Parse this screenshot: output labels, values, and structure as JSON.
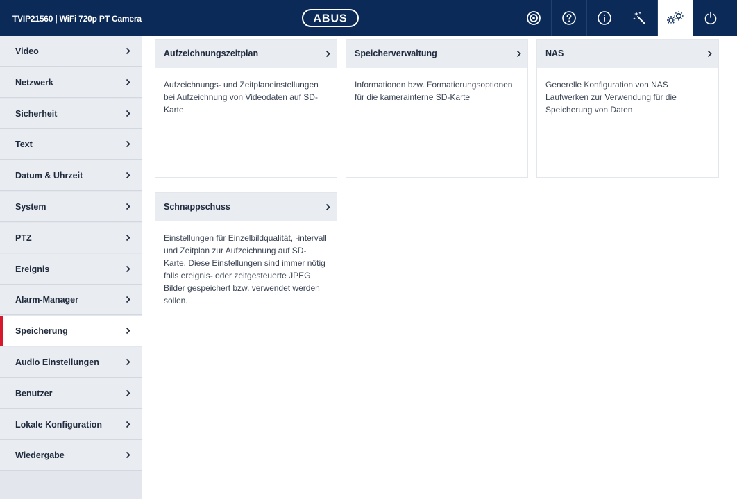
{
  "header": {
    "title": "TVIP21560  |  WiFi 720p PT Camera",
    "logo": "ABUS",
    "icons": [
      "live-view-icon",
      "help-icon",
      "info-icon",
      "wizard-icon",
      "settings-icon",
      "power-icon"
    ]
  },
  "sidebar": {
    "active_index": 9,
    "items": [
      {
        "label": "Video"
      },
      {
        "label": "Netzwerk"
      },
      {
        "label": "Sicherheit"
      },
      {
        "label": "Text"
      },
      {
        "label": "Datum & Uhrzeit"
      },
      {
        "label": "System"
      },
      {
        "label": "PTZ"
      },
      {
        "label": "Ereignis"
      },
      {
        "label": "Alarm-Manager"
      },
      {
        "label": "Speicherung"
      },
      {
        "label": "Audio Einstellungen"
      },
      {
        "label": "Benutzer"
      },
      {
        "label": "Lokale Konfiguration"
      },
      {
        "label": "Wiedergabe"
      }
    ]
  },
  "cards": [
    {
      "title": "Aufzeichnungszeitplan",
      "description": "Aufzeichnungs- und Zeitplaneinstellungen bei Aufzeichnung von Videodaten auf SD-Karte"
    },
    {
      "title": "Speicherverwaltung",
      "description": "Informationen bzw. Formatierungsoptionen für die kamerainterne SD-Karte"
    },
    {
      "title": "NAS",
      "description": "Generelle Konfiguration von NAS Laufwerken zur Verwendung für die Speicherung von Daten"
    },
    {
      "title": "Schnappschuss",
      "description": "Einstellungen für Einzelbildqualität, -intervall und Zeitplan zur Aufzeichnung auf SD-Karte. Diese Einstellungen sind immer nötig falls ereignis- oder zeitgesteuerte JPEG Bilder gespeichert bzw. verwendet werden sollen."
    }
  ],
  "colors": {
    "header_bg": "#0b2a58",
    "active_marker": "#d7192d",
    "sidebar_bg": "#e9ecf1"
  }
}
